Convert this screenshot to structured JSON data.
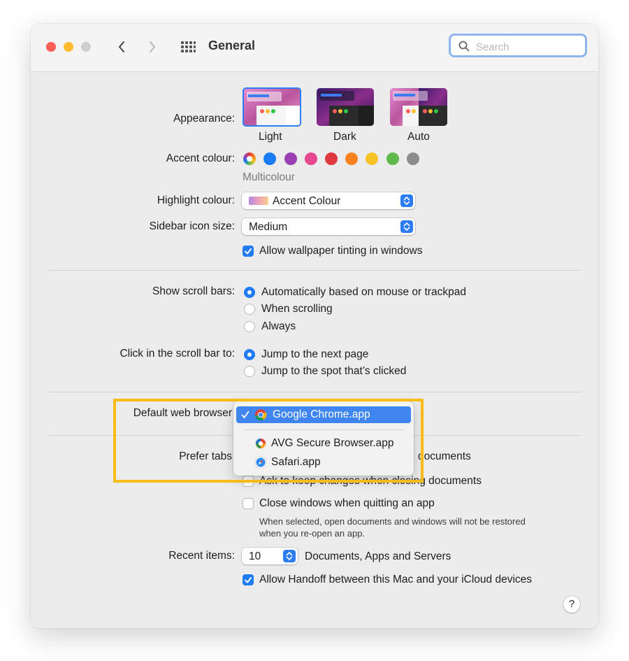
{
  "window": {
    "title": "General"
  },
  "search": {
    "placeholder": "Search"
  },
  "appearance": {
    "label": "Appearance:",
    "options": [
      {
        "label": "Light",
        "selected": true
      },
      {
        "label": "Dark",
        "selected": false
      },
      {
        "label": "Auto",
        "selected": false
      }
    ]
  },
  "accent": {
    "label": "Accent colour:",
    "selected_name": "Multicolour",
    "colors": [
      "multicolor",
      "#1a7cf5",
      "#9a40b2",
      "#e8488f",
      "#e0383e",
      "#f5821f",
      "#f7c427",
      "#5fb94a",
      "#8c8c8c"
    ]
  },
  "highlight": {
    "label": "Highlight colour:",
    "value": "Accent Colour"
  },
  "sidebar_icon": {
    "label": "Sidebar icon size:",
    "value": "Medium"
  },
  "wallpaper_tint": {
    "label": "Allow wallpaper tinting in windows",
    "checked": true
  },
  "scroll_bars": {
    "label": "Show scroll bars:",
    "options": [
      {
        "label": "Automatically based on mouse or trackpad",
        "selected": true
      },
      {
        "label": "When scrolling",
        "selected": false
      },
      {
        "label": "Always",
        "selected": false
      }
    ]
  },
  "click_scroll": {
    "label": "Click in the scroll bar to:",
    "options": [
      {
        "label": "Jump to the next page",
        "selected": true
      },
      {
        "label": "Jump to the spot that’s clicked",
        "selected": false
      }
    ]
  },
  "default_browser": {
    "label": "Default web browser",
    "menu": [
      {
        "label": "Google Chrome.app",
        "selected": true,
        "icon": "chrome-icon"
      },
      {
        "label": "AVG Secure Browser.app",
        "selected": false,
        "icon": "avg-browser-icon"
      },
      {
        "label": "Safari.app",
        "selected": false,
        "icon": "safari-icon"
      }
    ]
  },
  "prefer_tabs": {
    "label": "Prefer tabs",
    "trailing": "documents"
  },
  "ask_keep": {
    "label": "Ask to keep changes when closing documents",
    "checked": false
  },
  "close_windows": {
    "label": "Close windows when quitting an app",
    "checked": false,
    "note_line1": "When selected, open documents and windows will not be restored",
    "note_line2": "when you re-open an app."
  },
  "recent_items": {
    "label": "Recent items:",
    "value": "10",
    "suffix": "Documents, Apps and Servers"
  },
  "handoff": {
    "label": "Allow Handoff between this Mac and your iCloud devices",
    "checked": true
  },
  "help": {
    "label": "?"
  },
  "colors": {
    "accent_blue": "#1f7bf6",
    "highlight_frame": "#f8bb17",
    "menu_selection": "#3f86f1"
  }
}
